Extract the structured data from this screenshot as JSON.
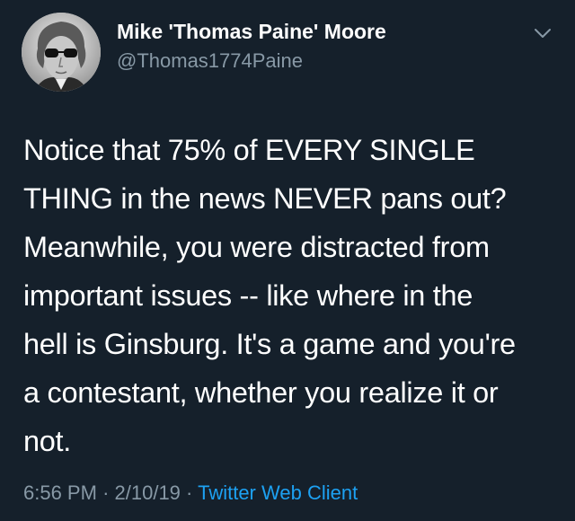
{
  "tweet": {
    "author": {
      "display_name": "Mike 'Thomas Paine' Moore",
      "handle": "@Thomas1774Paine",
      "avatar_icon": "portrait-with-sunglasses-avatar"
    },
    "menu_icon": "chevron-down-icon",
    "text": "Notice that 75% of EVERY SINGLE\nTHING in the news NEVER pans out?\nMeanwhile, you were distracted from\nimportant issues -- like where in the\nhell is Ginsburg. It's a game and you're\na contestant, whether you realize it or\nnot.",
    "time": "6:56 PM",
    "date": "2/10/19",
    "separator": "·",
    "source": "Twitter Web Client"
  },
  "colors": {
    "background": "#15202b",
    "primary_text": "#ffffff",
    "secondary_text": "#8899a6",
    "accent": "#1da1f2"
  }
}
